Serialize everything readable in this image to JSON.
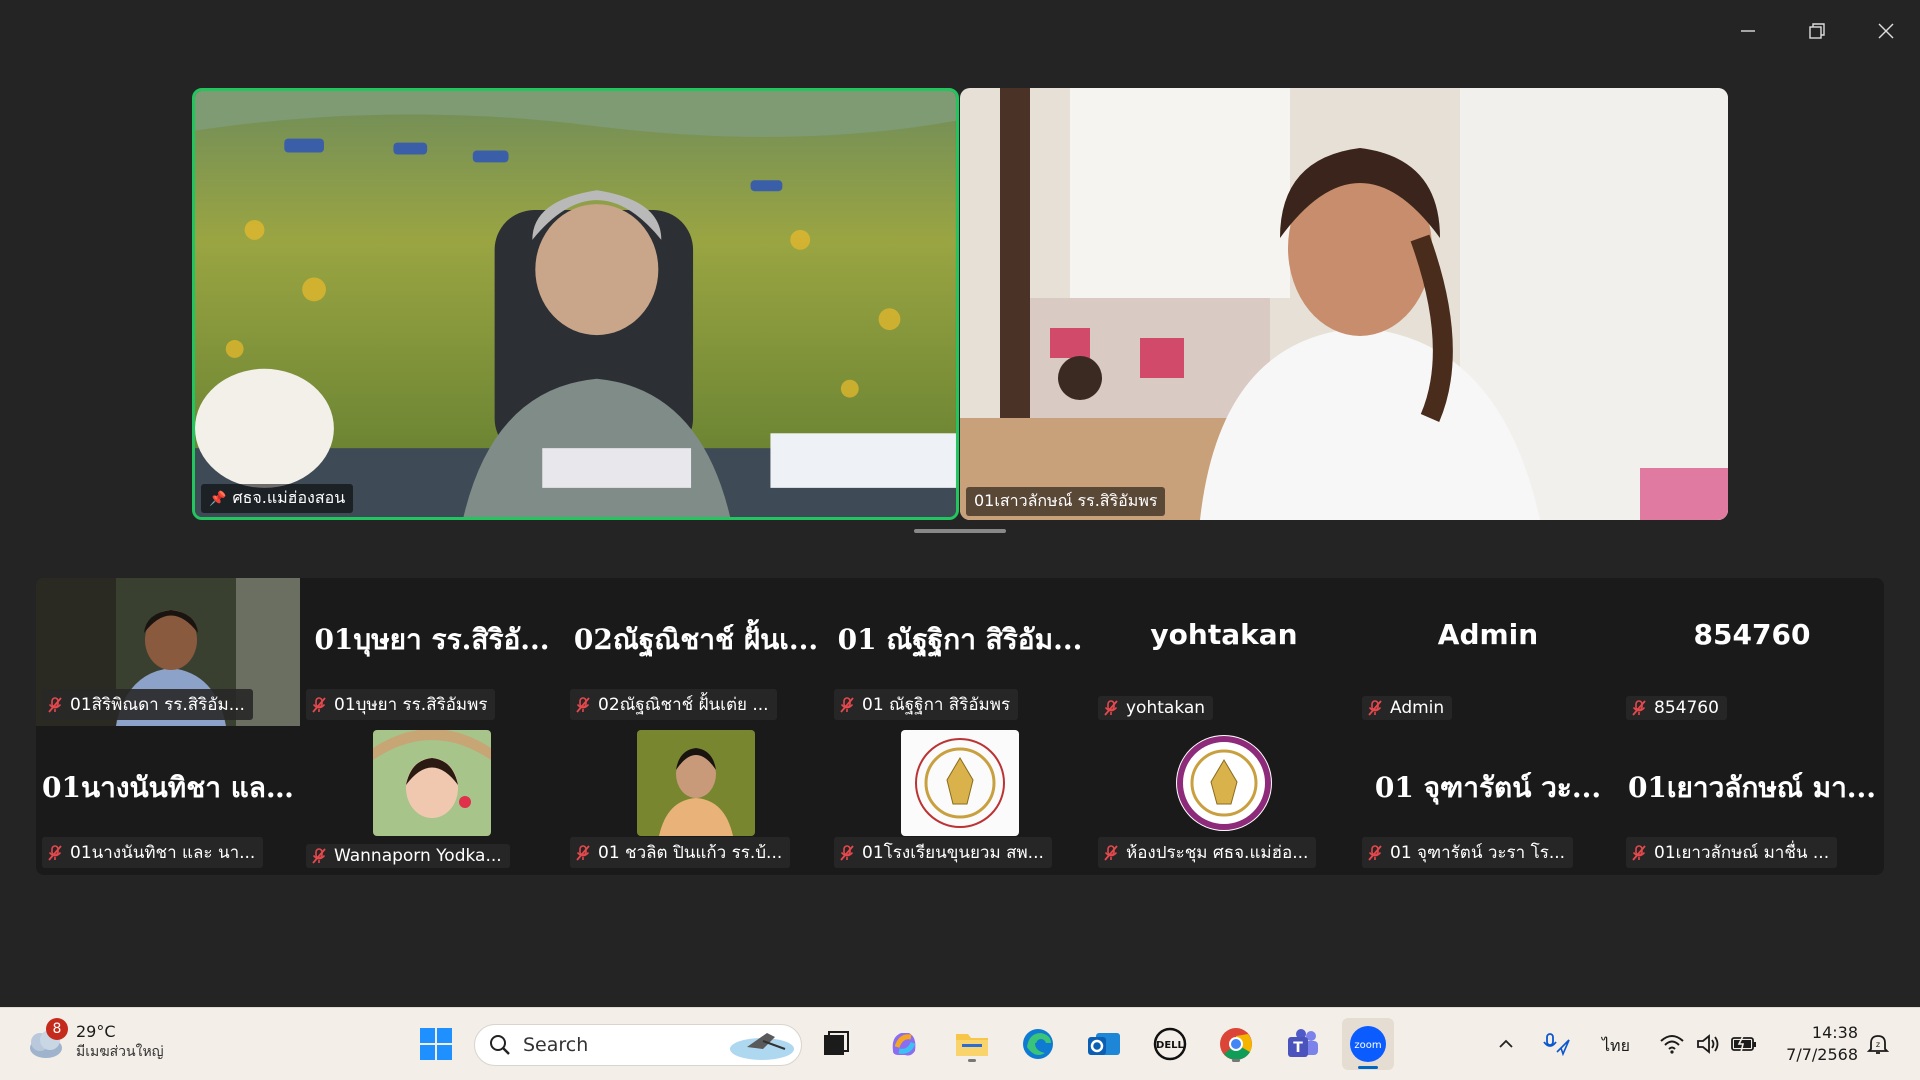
{
  "featured": [
    {
      "name": "ศธจ.แม่ฮ่องสอน",
      "pinned": true,
      "active_speaker": true
    },
    {
      "name": "01เสาวลักษณ์ รร.สิริอัมพร",
      "pinned": false
    }
  ],
  "gallery": {
    "row1": [
      {
        "big": "",
        "label": "01สิริพิณดา รร.สิริอัม...",
        "has_video": true
      },
      {
        "big": "01บุษยา รร.สิริอั...",
        "label": "01บุษยา รร.สิริอัมพร"
      },
      {
        "big": "02ณัฐณิชาช์ ฝั้นเ...",
        "label": "02ณัฐณิชาช์ ฝั้นเต่ย ..."
      },
      {
        "big": "01 ณัฐฐิกา สิริอัม...",
        "label": "01 ณัฐฐิกา สิริอัมพร"
      },
      {
        "big": "yohtakan",
        "label": "yohtakan"
      },
      {
        "big": "Admin",
        "label": "Admin"
      },
      {
        "big": "854760",
        "label": "854760"
      }
    ],
    "row2": [
      {
        "big": "01นางนันทิชา แล...",
        "label": "01นางนันทิชา และ นา..."
      },
      {
        "big": "",
        "label": "Wannaporn Yodka...",
        "has_photo": "girl"
      },
      {
        "big": "",
        "label": "01 ชวลิต ปินแก้ว รร.บ้...",
        "has_photo": "man"
      },
      {
        "big": "",
        "label": "01โรงเรียนขุนยวม สพ...",
        "has_photo": "seal1"
      },
      {
        "big": "",
        "label": "ห้องประชุม ศธจ.แม่ฮ่อ...",
        "has_photo": "seal2"
      },
      {
        "big": "01 จุฑารัตน์ วะ...",
        "label": "01 จุฑารัตน์ วะรา โร..."
      },
      {
        "big": "01เยาวลักษณ์ มา...",
        "label": "01เยาวลักษณ์ มาชื่น ..."
      }
    ]
  },
  "taskbar": {
    "weather_badge": "8",
    "temperature": "29°C",
    "weather_condition": "มีเมฆส่วนใหญ่",
    "search_placeholder": "Search",
    "language": "ไทย",
    "time": "14:38",
    "date": "7/7/2568"
  },
  "colors": {
    "active_speaker_border": "#22c55e",
    "app_bg": "#242424",
    "taskbar_bg": "#f3eee7"
  }
}
